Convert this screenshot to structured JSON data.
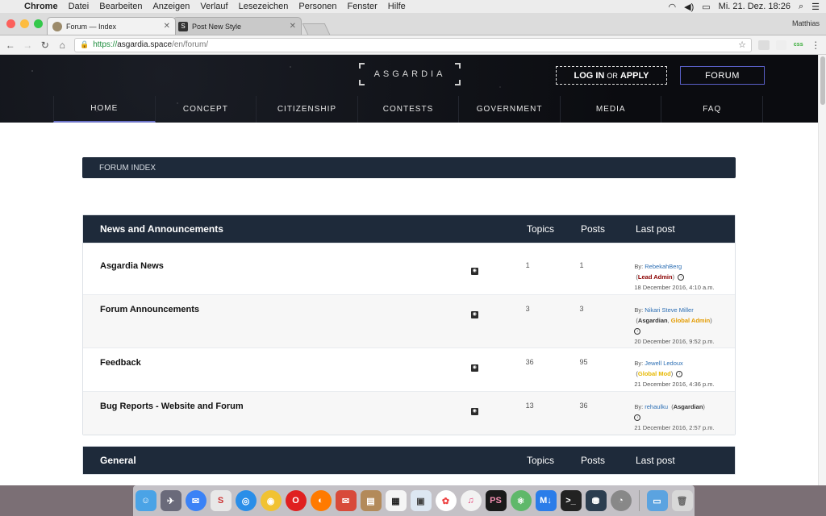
{
  "menubar": {
    "app": "Chrome",
    "items": [
      "Datei",
      "Bearbeiten",
      "Anzeigen",
      "Verlauf",
      "Lesezeichen",
      "Personen",
      "Fenster",
      "Hilfe"
    ],
    "clock": "Mi. 21. Dez.  18:26"
  },
  "browser": {
    "tabs": [
      {
        "title": "Forum — Index",
        "active": true
      },
      {
        "title": "Post New Style",
        "active": false
      }
    ],
    "profile": "Matthias",
    "url_scheme": "https://",
    "url_host": "asgardia.space",
    "url_path": "/en/forum/",
    "ext_label": "css"
  },
  "site": {
    "logo": "ASGARDIA",
    "login_strong1": "LOG IN",
    "login_or": "OR",
    "login_strong2": "APPLY",
    "forum_button": "FORUM",
    "nav": [
      "HOME",
      "CONCEPT",
      "CITIZENSHIP",
      "CONTESTS",
      "GOVERNMENT",
      "MEDIA",
      "FAQ"
    ]
  },
  "breadcrumb": "FORUM INDEX",
  "categories": [
    {
      "title": "News and Announcements",
      "col_topics": "Topics",
      "col_posts": "Posts",
      "col_last": "Last post",
      "forums": [
        {
          "name": "Asgardia News",
          "topics": "1",
          "posts": "1",
          "by": "By:",
          "user": "RebekahBerg",
          "role": "Lead Admin",
          "date": "18 December 2016, 4:10 a.m."
        },
        {
          "name": "Forum Announcements",
          "topics": "3",
          "posts": "3",
          "by": "By:",
          "user": "Nikari Steve Miller",
          "role1": "Asgardian",
          "role2": "Global Admin",
          "date": "20 December 2016, 9:52 p.m."
        },
        {
          "name": "Feedback",
          "topics": "36",
          "posts": "95",
          "by": "By:",
          "user": "Jewell Ledoux",
          "role": "Global Mod",
          "date": "21 December 2016, 4:36 p.m."
        },
        {
          "name": "Bug Reports - Website and Forum",
          "topics": "13",
          "posts": "36",
          "by": "By:",
          "user": "rehaulku",
          "role": "Asgardian",
          "date": "21 December 2016, 2:57 p.m."
        }
      ]
    },
    {
      "title": "General",
      "col_topics": "Topics",
      "col_posts": "Posts",
      "col_last": "Last post"
    }
  ],
  "colors": {
    "header_bg": "#1e2a3a",
    "accent": "#6c73c8",
    "user_link": "#2d6fb4",
    "role_lead": "#8b0000",
    "role_global": "#e39b00"
  }
}
